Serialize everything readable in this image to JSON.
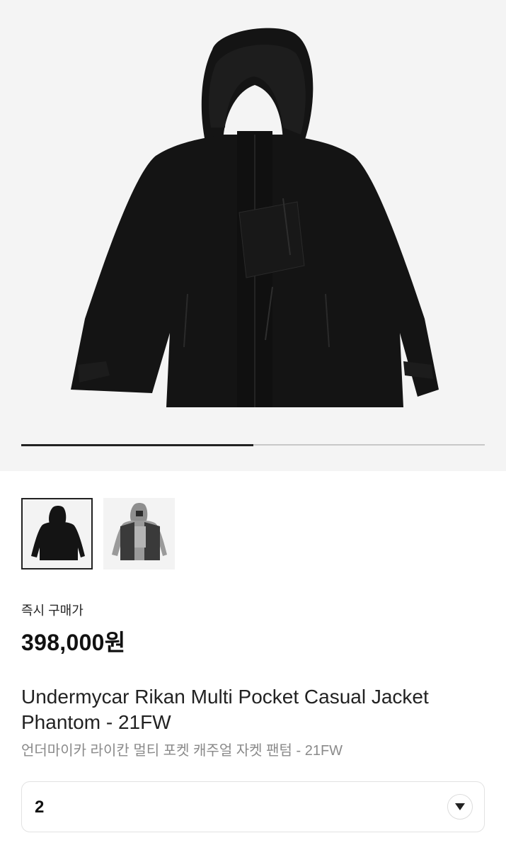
{
  "gallery": {
    "main_image": "black-jacket-photo",
    "current_index": 1,
    "total_images": 2,
    "progress_fraction": 0.5,
    "thumbnails": [
      {
        "name": "black-jacket-thumbnail",
        "selected": true
      },
      {
        "name": "grey-jacket-thumbnail",
        "selected": false
      }
    ]
  },
  "price": {
    "label": "즉시 구매가",
    "value": "398,000원"
  },
  "product": {
    "title": "Undermycar Rikan Multi Pocket Casual Jacket Phantom - 21FW",
    "subtitle": "언더마이카 라이칸 멀티 포켓 캐주얼 자켓 팬텀 - 21FW"
  },
  "size_select": {
    "value": "2",
    "icon": "chevron-down-icon"
  },
  "colors": {
    "hero_bg": "#f4f4f4",
    "jacket": "#141414",
    "text": "#222222",
    "muted": "#8a8a8a"
  }
}
